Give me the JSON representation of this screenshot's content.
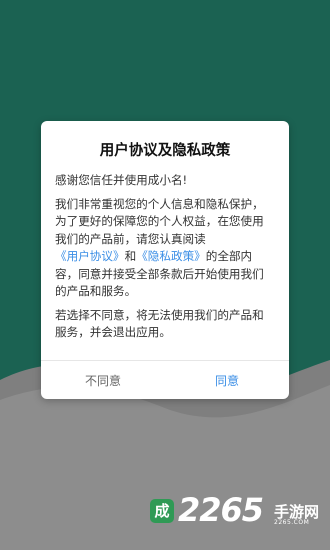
{
  "dialog": {
    "title": "用户协议及隐私政策",
    "greeting": "感谢您信任并使用成小名!",
    "para1_pre": "我们非常重视您的个人信息和隐私保护，为了更好的保障您的个人权益，在您使用我们的产品前，请您认真阅读",
    "link_user": "《用户协议》",
    "para1_mid": "和",
    "link_privacy": "《隐私政策》",
    "para1_post": "的全部内容，同意并接受全部条款后开始使用我们的产品和服务。",
    "para2": "若选择不同意，将无法使用我们的产品和服务，并会退出应用。",
    "cancel_label": "不同意",
    "ok_label": "同意"
  },
  "watermark": {
    "badge": "成",
    "number": "2265",
    "site": "手游网",
    "sub": "2265.COM"
  },
  "colors": {
    "background": "#1e6b5a",
    "link": "#3a8ee6",
    "watermark_badge": "#2f9a55"
  }
}
